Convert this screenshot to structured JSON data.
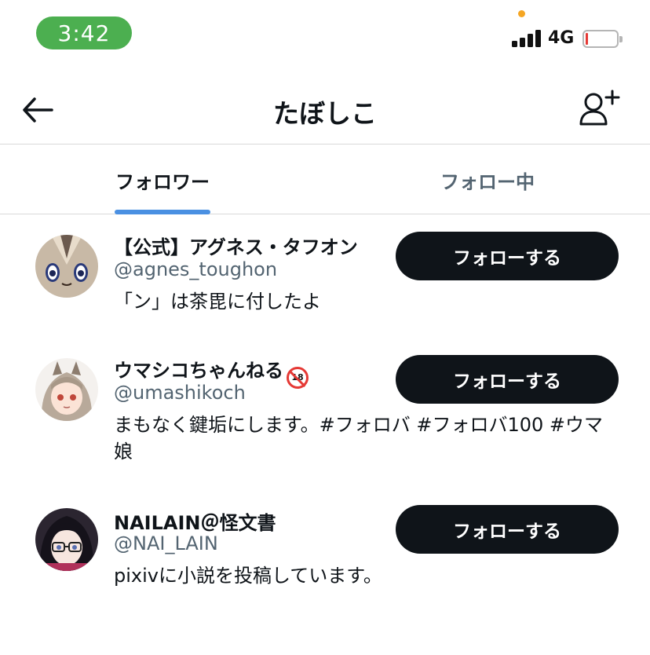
{
  "status_bar": {
    "time": "3:42",
    "network": "4G",
    "colors": {
      "time_pill": "#4caf50",
      "battery_low": "#e53935",
      "dot": "#f5a623"
    }
  },
  "header": {
    "title": "たぼしこ",
    "back_icon": "arrow-left-icon",
    "add_user_icon": "person-add-icon"
  },
  "tabs": [
    {
      "label": "フォロワー",
      "active": true
    },
    {
      "label": "フォロー中",
      "active": false
    }
  ],
  "accent_color": "#4a90e2",
  "users": [
    {
      "name": "【公式】アグネス・タフオン",
      "handle": "@agnes_toughon",
      "bio": "「ン」は茶毘に付したよ",
      "button": "フォローする"
    },
    {
      "name": "ウマシコちゃんねる",
      "badge": "18",
      "handle": "@umashikoch",
      "bio": "まもなく鍵垢にします。#フォロバ #フォロバ100 #ウマ娘",
      "button": "フォローする"
    },
    {
      "name": "NAILAIN＠怪文書",
      "handle": "@NAI_LAIN",
      "bio": "pixivに小説を投稿しています。",
      "button": "フォローする"
    }
  ]
}
